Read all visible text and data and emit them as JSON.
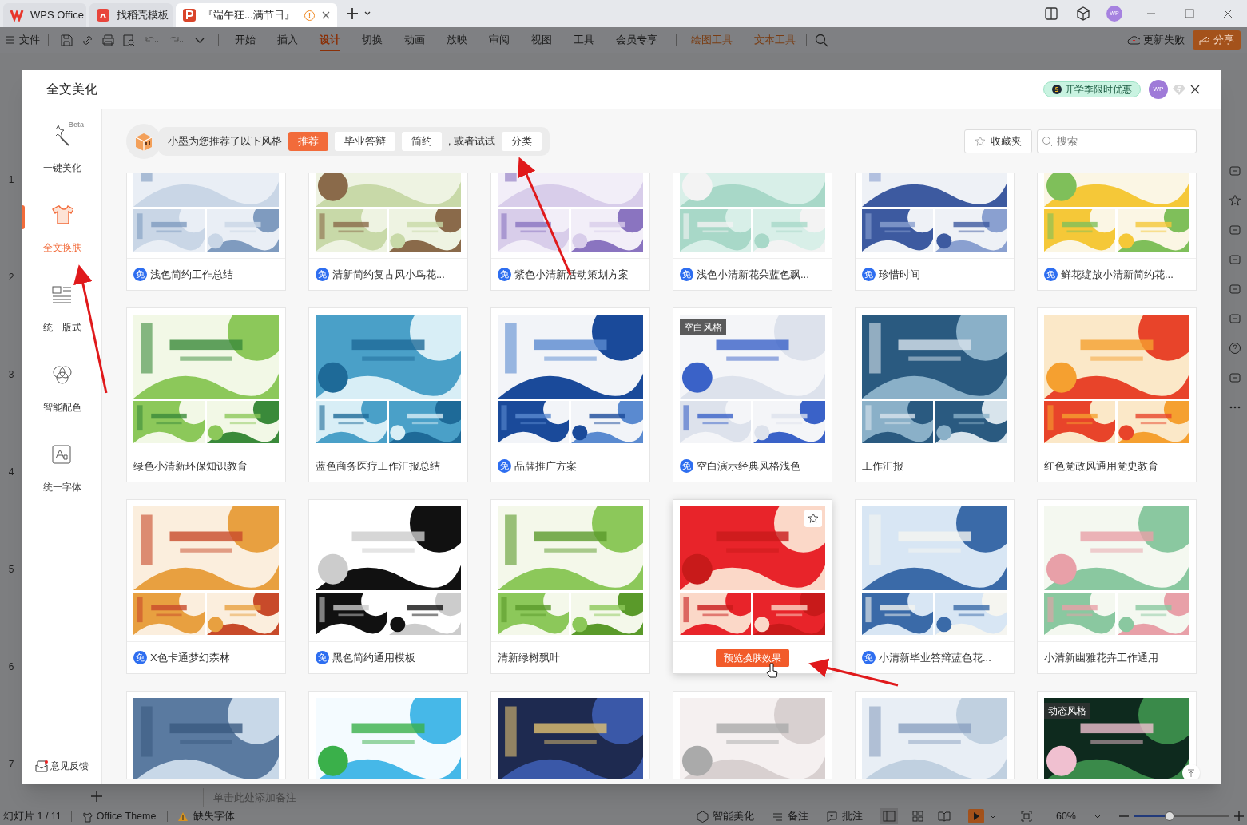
{
  "app_tabs": [
    {
      "label": "WPS Office",
      "selected": false,
      "kind": "wps"
    },
    {
      "label": "找稻壳模板",
      "selected": false,
      "kind": "docer"
    },
    {
      "label": "『端午狂...满节日』",
      "selected": true,
      "kind": "ppt",
      "warning": "!"
    }
  ],
  "account": {
    "avatar": "WP"
  },
  "toolbar": {
    "file": "文件",
    "ribbon_tabs": [
      {
        "label": "开始",
        "selected": false,
        "kind": "normal"
      },
      {
        "label": "插入",
        "selected": false,
        "kind": "normal"
      },
      {
        "label": "设计",
        "selected": true,
        "kind": "normal"
      },
      {
        "label": "切换",
        "selected": false,
        "kind": "normal"
      },
      {
        "label": "动画",
        "selected": false,
        "kind": "normal"
      },
      {
        "label": "放映",
        "selected": false,
        "kind": "normal"
      },
      {
        "label": "审阅",
        "selected": false,
        "kind": "normal"
      },
      {
        "label": "视图",
        "selected": false,
        "kind": "normal"
      },
      {
        "label": "工具",
        "selected": false,
        "kind": "normal"
      },
      {
        "label": "会员专享",
        "selected": false,
        "kind": "normal"
      },
      {
        "label": "绘图工具",
        "selected": false,
        "kind": "context"
      },
      {
        "label": "文本工具",
        "selected": false,
        "kind": "context"
      }
    ],
    "sync_status": "更新失败",
    "share": "分享"
  },
  "slide_numbers": [
    "1",
    "2",
    "3",
    "4",
    "5",
    "6",
    "7"
  ],
  "dialog": {
    "title": "全文美化",
    "promo": "开学季限时优惠",
    "avatar": "WP",
    "sidebar": [
      {
        "label": "一键美化",
        "badge": "Beta",
        "selected": false,
        "kind": "wand"
      },
      {
        "label": "全文换肤",
        "selected": true,
        "kind": "shirt"
      },
      {
        "label": "统一版式",
        "selected": false,
        "kind": "layout"
      },
      {
        "label": "智能配色",
        "selected": false,
        "kind": "palette"
      },
      {
        "label": "统一字体",
        "selected": false,
        "kind": "font"
      }
    ],
    "feedback": "意见反馈",
    "suggest": {
      "text": "小墨为您推荐了以下风格",
      "chips": [
        {
          "label": "推荐",
          "selected": true
        },
        {
          "label": "毕业答辩",
          "selected": false
        },
        {
          "label": "简约",
          "selected": false
        }
      ],
      "or_try": ", 或者试试",
      "category": "分类"
    },
    "favorites": "收藏夹",
    "search": {
      "placeholder": "搜索"
    },
    "templates": [
      {
        "title": "浅色简约工作总结",
        "free": "免"
      },
      {
        "title": "清新简约复古风小鸟花...",
        "free": "免"
      },
      {
        "title": "紫色小清新活动策划方案",
        "free": "免"
      },
      {
        "title": "浅色小清新花朵蓝色飘...",
        "free": "免"
      },
      {
        "title": "珍惜时间",
        "free": "免"
      },
      {
        "title": "鲜花绽放小清新简约花...",
        "free": "免"
      },
      {
        "title": "绿色小清新环保知识教育"
      },
      {
        "title": "蓝色商务医疗工作汇报总结"
      },
      {
        "title": "品牌推广方案",
        "free": "免"
      },
      {
        "title": "空白演示经典风格浅色",
        "free": "免",
        "tag": "空白风格"
      },
      {
        "title": "工作汇报"
      },
      {
        "title": "红色党政风通用党史教育"
      },
      {
        "title": "X色卡通梦幻森林",
        "free": "免"
      },
      {
        "title": "黑色简约通用模板",
        "free": "免"
      },
      {
        "title": "清新绿树飘叶"
      },
      {
        "hovered": true,
        "button": "预览换肤效果"
      },
      {
        "title": "小清新毕业答辩蓝色花...",
        "free": "免"
      },
      {
        "title": "小清新幽雅花卉工作通用"
      },
      {
        "kind": "picture"
      },
      {
        "kind": "picture"
      },
      {
        "kind": "picture"
      },
      {
        "kind": "picture"
      },
      {
        "kind": "picture"
      },
      {
        "kind": "picture",
        "tag": "动态风格"
      }
    ]
  },
  "notes_placeholder": "单击此处添加备注",
  "status_bar": {
    "slide": "幻灯片 1 / 11",
    "theme": "Office Theme",
    "missing_font": "缺失字体",
    "beautify": "智能美化",
    "notes": "备注",
    "comments": "批注",
    "zoom": "60%",
    "zoom_slider": {
      "level": 0.35
    }
  }
}
